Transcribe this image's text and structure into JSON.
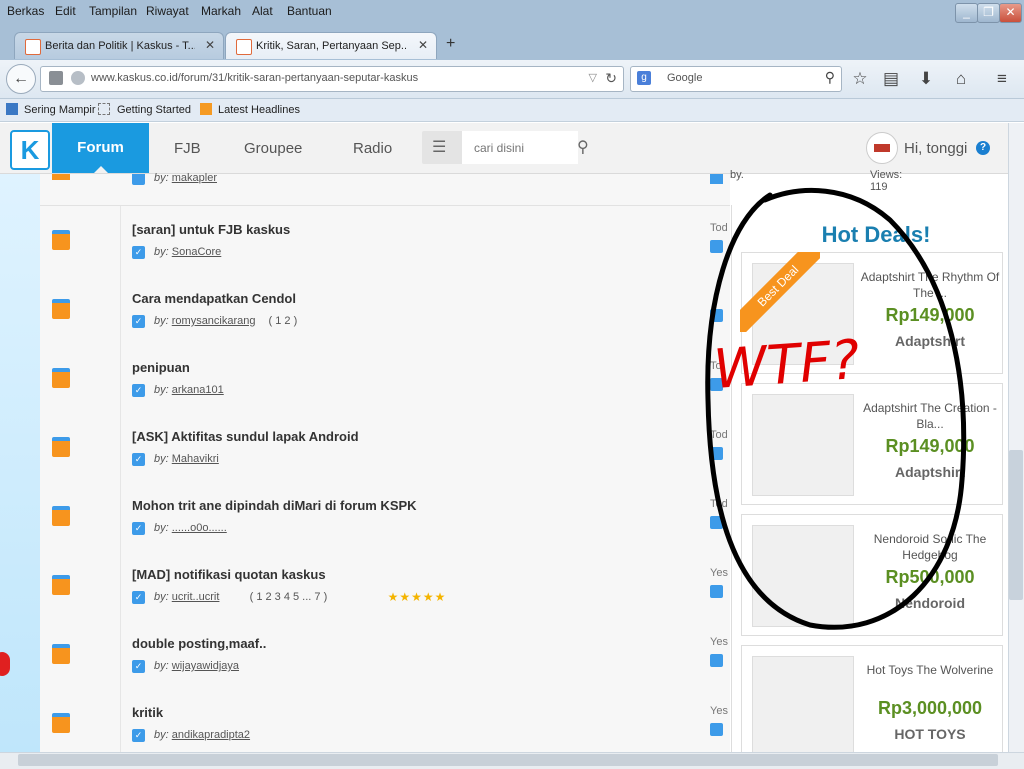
{
  "menu": [
    "Berkas",
    "Edit",
    "Tampilan",
    "Riwayat",
    "Markah",
    "Alat",
    "Bantuan"
  ],
  "window_buttons": {
    "minimize": "_",
    "restore": "❐",
    "close": "✕"
  },
  "tabs": [
    {
      "title": "Berita dan Politik | Kaskus - T...",
      "active": false
    },
    {
      "title": "Kritik, Saran, Pertanyaan Sep...",
      "active": true
    }
  ],
  "new_tab": "+",
  "url": "www.kaskus.co.id/forum/31/kritik-saran-pertanyaan-seputar-kaskus",
  "search_engine_placeholder": "Google",
  "bookmarks": [
    "Sering Mampir",
    "Getting Started",
    "Latest Headlines"
  ],
  "site": {
    "logo": "K",
    "nav": [
      "Forum",
      "FJB",
      "Groupee",
      "Radio"
    ],
    "search_placeholder": "cari disini",
    "greeting": "Hi, tonggi",
    "help": "?"
  },
  "top_partial": {
    "by_prefix": "by:",
    "user": "makapler",
    "by2_prefix": "by.",
    "by2_user": "",
    "views": "Views: 119"
  },
  "threads": [
    {
      "title": "[saran] untuk FJB kaskus",
      "user": "SonaCore",
      "pages": "",
      "stars": "",
      "date": "Tod"
    },
    {
      "title": "Cara mendapatkan Cendol",
      "user": "romysancikarang",
      "pages": "( 1 2 )",
      "stars": "",
      "date": ""
    },
    {
      "title": "penipuan",
      "user": "arkana101",
      "pages": "",
      "stars": "",
      "date": "To"
    },
    {
      "title": "[ASK] Aktifitas sundul lapak Android",
      "user": "Mahavikri",
      "pages": "",
      "stars": "",
      "date": "Tod"
    },
    {
      "title": "Mohon trit ane dipindah diMari di forum KSPK",
      "user": "......o0o......",
      "pages": "",
      "stars": "",
      "date": "Tod"
    },
    {
      "title": "[MAD] notifikasi quotan kaskus",
      "user": "ucrit..ucrit",
      "pages": "( 1 2 3 4 5 ... 7 )",
      "stars": "★★★★★",
      "date": "Yes"
    },
    {
      "title": "double posting,maaf..",
      "user": "wijayawidjaya",
      "pages": "",
      "stars": "",
      "date": "Yes"
    },
    {
      "title": "kritik",
      "user": "andikapradipta2",
      "pages": "",
      "stars": "",
      "date": "Yes"
    }
  ],
  "by_label": "by:",
  "hot_deals": {
    "title": "Hot Deals!",
    "badge": "Best Deal",
    "items": [
      {
        "name": "Adaptshirt The Rhythm Of The ...",
        "price": "Rp149,000",
        "brand": "Adaptshirt"
      },
      {
        "name": "Adaptshirt The Creation - Bla...",
        "price": "Rp149,000",
        "brand": "Adaptshirt"
      },
      {
        "name": "Nendoroid Sonic The Hedgehog",
        "price": "Rp500,000",
        "brand": "Nendoroid"
      },
      {
        "name": "Hot Toys The Wolverine",
        "price": "Rp3,000,000",
        "brand": "HOT TOYS"
      }
    ]
  },
  "annotation_text": "WTF?",
  "colors": {
    "brand": "#1a9ae0",
    "price": "#5b8f22",
    "annotation": "#e00000"
  }
}
